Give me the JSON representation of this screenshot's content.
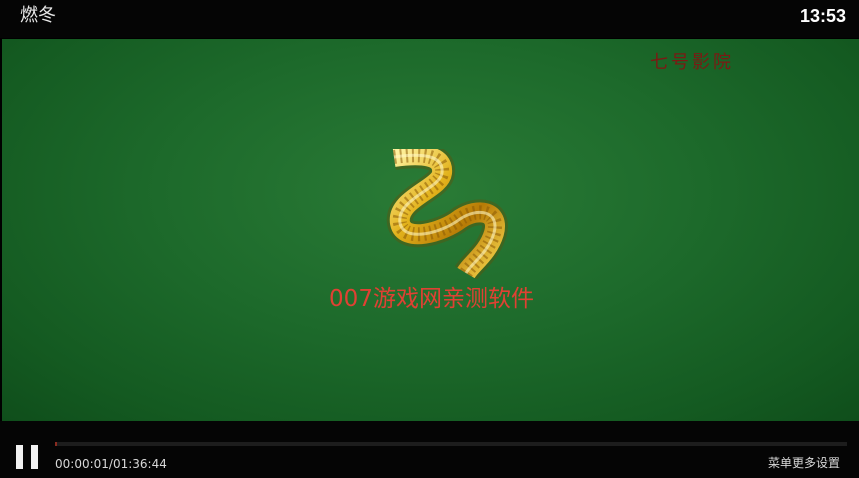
{
  "header": {
    "title": "燃冬",
    "clock": "13:53"
  },
  "video": {
    "watermark": "七号影院",
    "caption": "007游戏网亲测软件",
    "logo_icon": "film-reel-logo-icon"
  },
  "controls": {
    "pause_icon": "pause-icon",
    "position": "00:00:01",
    "duration": "01:36:44",
    "time_label": "00:00:01/01:36:44",
    "progress_fraction": 0.0002,
    "menu_hint": "菜单更多设置"
  },
  "colors": {
    "video_background": "#1d6a2b",
    "caption": "#e04133",
    "watermark": "#7a1a14",
    "progress_fill": "#8a2b20"
  }
}
